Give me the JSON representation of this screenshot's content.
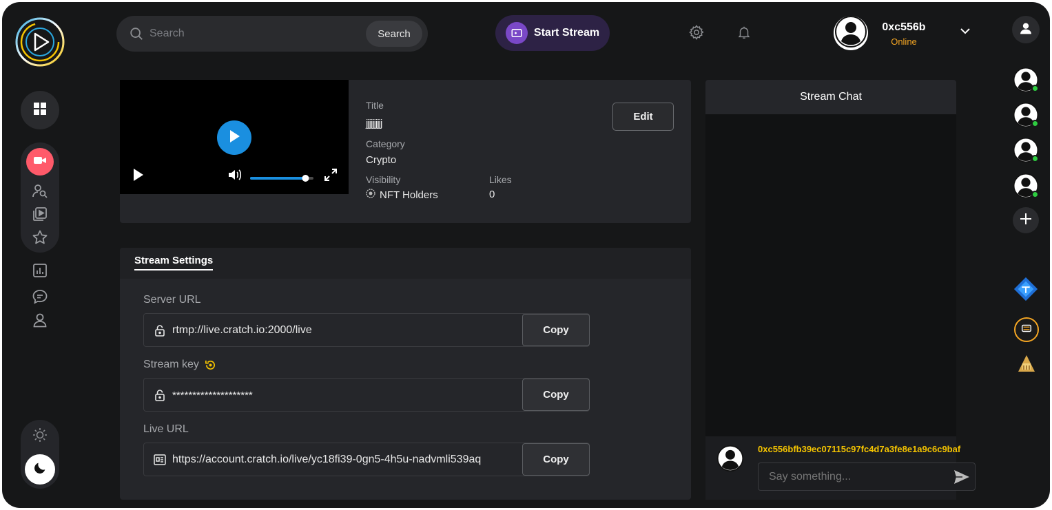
{
  "topbar": {
    "search_placeholder": "Search",
    "search_button": "Search",
    "start_stream": "Start Stream",
    "user_name": "0xc556b",
    "user_status": "Online"
  },
  "video": {
    "volume_fraction": 0.92
  },
  "details": {
    "title_label": "Title",
    "title_value": "jjjjjjjjjj",
    "category_label": "Category",
    "category_value": "Crypto",
    "visibility_label": "Visibility",
    "visibility_value": "NFT Holders",
    "likes_label": "Likes",
    "likes_value": "0",
    "edit_button": "Edit"
  },
  "settings": {
    "tab_label": "Stream Settings",
    "server_url_label": "Server URL",
    "server_url_value": "rtmp://live.cratch.io:2000/live",
    "stream_key_label": "Stream key",
    "stream_key_value": "********************",
    "live_url_label": "Live URL",
    "live_url_value": "https://account.cratch.io/live/yc18fi39-0gn5-4h5u-nadvmli539aq",
    "copy_label": "Copy"
  },
  "chat": {
    "header": "Stream Chat",
    "wallet": "0xc556bfb39ec07115c97fc4d7a3fe8e1a9c6c9baf",
    "input_placeholder": "Say something..."
  },
  "colors": {
    "background": "#161718",
    "card": "#25262a",
    "accent_purple": "#7a48c7",
    "accent_blue": "#1a8fe0",
    "online_orange": "#f5a623",
    "wallet_yellow": "#f5c400",
    "online_dot": "#2ecc40",
    "live_red": "#ff5a6a"
  }
}
